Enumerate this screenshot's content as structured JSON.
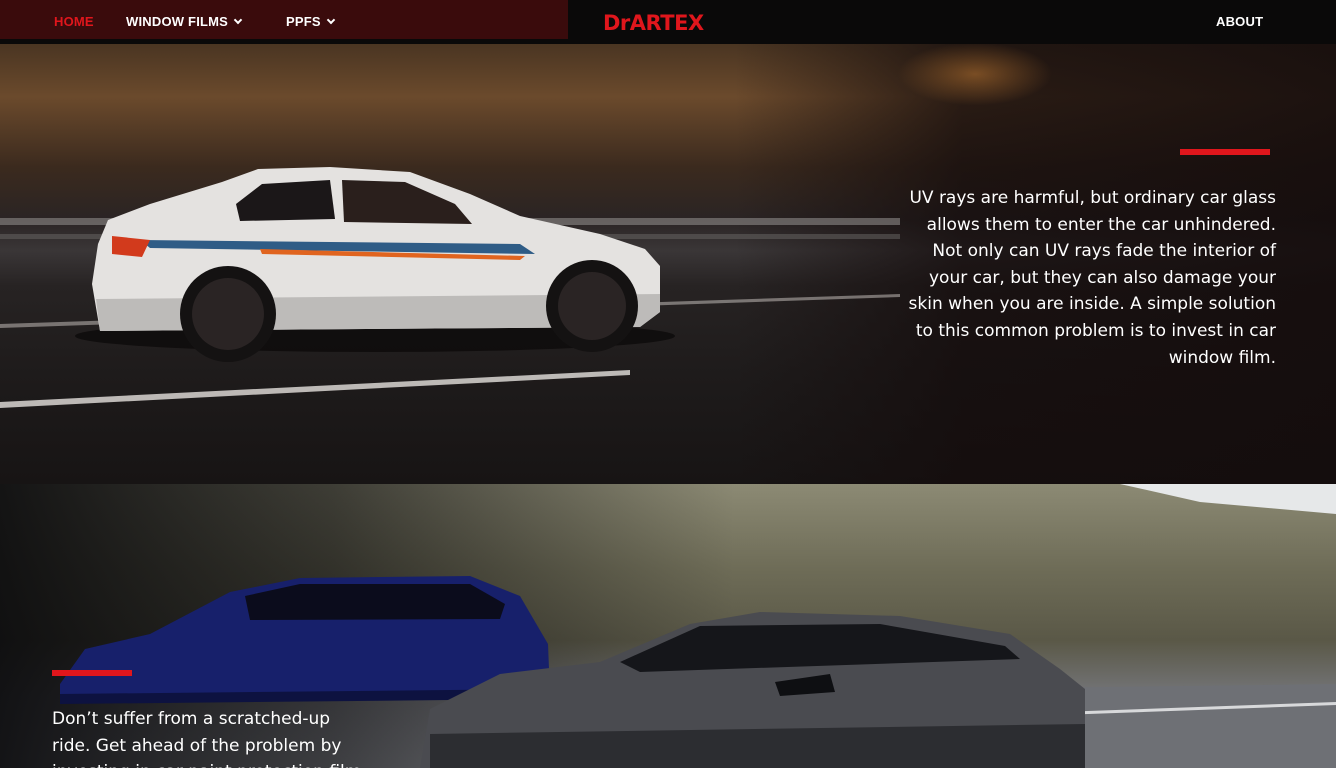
{
  "nav": {
    "home_label": "HOME",
    "window_films_label": "WINDOW FILMS",
    "ppfs_label": "PPFS",
    "logo_text": "DrARTEX",
    "about_label": "ABOUT"
  },
  "section1": {
    "body": "UV rays are harmful, but ordinary car glass allows them to enter the car unhindered. Not only can UV rays fade the interior of your car, but they can also damage your skin when you are inside. A simple solution to this common problem is to invest in car window film."
  },
  "section2": {
    "body": "Don’t suffer from a scratched-up ride. Get ahead of the problem by investing in car paint protection film"
  },
  "colors": {
    "accent": "#e0161c",
    "nav_left_bg": "#3a0b0c",
    "nav_bg": "#0a0909"
  }
}
